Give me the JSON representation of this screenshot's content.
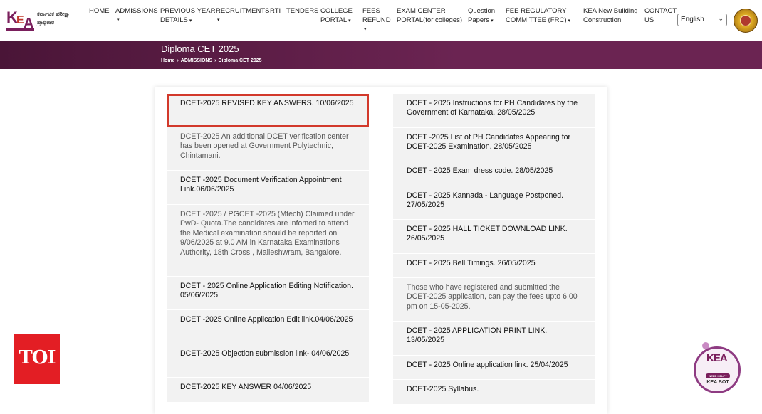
{
  "logo": {
    "mark": [
      "K",
      "E",
      "A"
    ],
    "kannada_text": "ಕರ್ನಾಟಕ ಪರೀಕ್ಷಾ ಪ್ರಾಧಿಕಾರ"
  },
  "nav": {
    "home": "HOME",
    "admissions": "ADMISSIONS",
    "previous_year_line1": "PREVIOUS YEAR",
    "previous_year_line2": "DETAILS",
    "recruitments": "RECRUITMENTS",
    "rti": "RTI",
    "tenders": "TENDERS",
    "college_line1": "COLLEGE",
    "college_line2": "PORTAL",
    "fees_line1": "FEES",
    "fees_line2": "REFUND",
    "exam_center_line1": "EXAM CENTER",
    "exam_center_line2": "PORTAL(for colleges)",
    "question_line1": "Question",
    "question_line2": "Papers",
    "fee_reg_line1": "FEE REGULATORY",
    "fee_reg_line2": "COMMITTEE (FRC)",
    "kea_building_line1": "KEA New Building",
    "kea_building_line2": "Construction",
    "contact_line1": "CONTACT",
    "contact_line2": "US"
  },
  "language": {
    "selected": "English"
  },
  "banner": {
    "title": "Diploma CET 2025",
    "breadcrumb": [
      "Home",
      "ADMISSIONS",
      "Diploma CET 2025"
    ]
  },
  "left_items": [
    "DCET-2025 REVISED KEY ANSWERS. 10/06/2025",
    "DCET-2025 An additional DCET verification center has been opened at Government Polytechnic, Chintamani.",
    "DCET -2025 Document Verification Appointment Link.06/06/2025",
    "DCET -2025 / PGCET -2025 (Mtech) Claimed under PwD- Quota.The candidates are infomed to attend the Medical examination should be reported on 9/06/2025 at 9.0 AM in Karnataka Examinations Authority, 18th Cross , Malleshwram, Bangalore.",
    "DCET - 2025 Online Application Editing Notification. 05/06/2025",
    "DCET -2025 Online Application Edit link.04/06/2025",
    "DCET-2025 Objection submission link- 04/06/2025",
    "DCET-2025 KEY ANSWER 04/06/2025"
  ],
  "right_items": [
    "DCET - 2025 Instructions for PH Candidates by the Government of Karnataka. 28/05/2025",
    "DCET -2025 List of PH Candidates Appearing for DCET-2025 Examination. 28/05/2025",
    "DCET - 2025 Exam dress code. 28/05/2025",
    "DCET - 2025 Kannada - Language Postponed. 27/05/2025",
    "DCET - 2025 HALL TICKET DOWNLOAD LINK. 26/05/2025",
    "DCET - 2025 Bell Timings. 26/05/2025",
    "Those who have registered and submitted the DCET-2025 application, can pay the fees upto 6.00 pm on 15-05-2025.",
    "DCET - 2025 APPLICATION PRINT LINK. 13/05/2025",
    "DCET - 2025 Online application link. 25/04/2025",
    "DCET-2025 Syllabus."
  ],
  "toi_badge": "TOI",
  "kea_bot": {
    "mark": "KEA",
    "help": "NEED HELP?",
    "label": "KEA BOT"
  },
  "colors": {
    "banner": "#6b2452",
    "highlight_border": "#d2392b",
    "item_background": "#f2f2f2",
    "toi_red": "#e31e24"
  }
}
